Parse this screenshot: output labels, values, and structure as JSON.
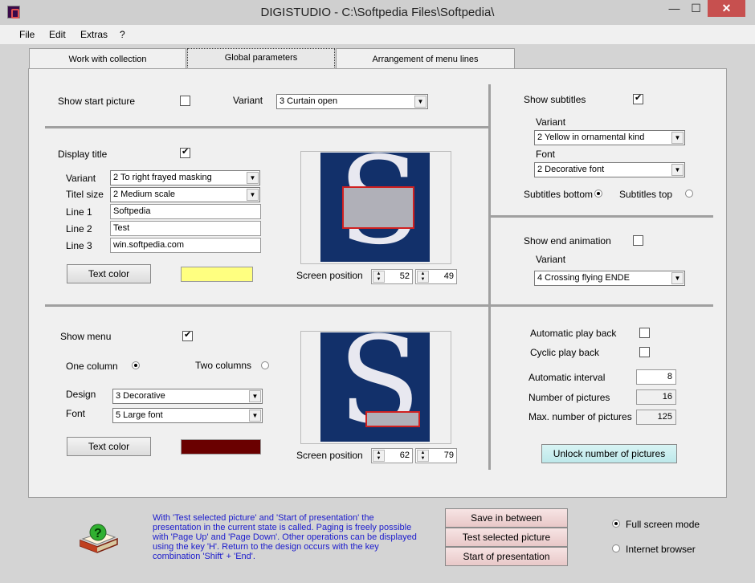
{
  "window": {
    "title": "DIGISTUDIO - C:\\Softpedia Files\\Softpedia\\",
    "min": "—",
    "max": "☐",
    "close": "✕"
  },
  "menu": [
    "File",
    "Edit",
    "Extras",
    "?"
  ],
  "tabs": [
    "Work with collection",
    "Global parameters",
    "Arrangement of menu lines"
  ],
  "start_picture": {
    "label": "Show start picture",
    "checked": false,
    "variant_label": "Variant",
    "variant": "3 Curtain open"
  },
  "title": {
    "label": "Display title",
    "checked": true,
    "variant_label": "Variant",
    "variant": "2 To right frayed masking",
    "size_label": "Titel size",
    "size": "2 Medium scale",
    "line1_label": "Line 1",
    "line1": "Softpedia",
    "line2_label": "Line 2",
    "line2": "Test",
    "line3_label": "Line 3",
    "line3": "win.softpedia.com",
    "text_color_label": "Text color",
    "color": "#ffff80",
    "screen_position_label": "Screen position",
    "pos_x": "52",
    "pos_y": "49"
  },
  "menu_opts": {
    "label": "Show menu",
    "checked": true,
    "one_column": "One column",
    "two_columns": "Two columns",
    "selected": "one",
    "design_label": "Design",
    "design": "3 Decorative",
    "font_label": "Font",
    "font": "5 Large font",
    "text_color_label": "Text color",
    "color": "#6a0000",
    "screen_position_label": "Screen position",
    "pos_x": "62",
    "pos_y": "79"
  },
  "subtitles": {
    "label": "Show subtitles",
    "checked": true,
    "variant_label": "Variant",
    "variant": "2 Yellow in ornamental kind",
    "font_label": "Font",
    "font": "2 Decorative font",
    "bottom": "Subtitles bottom",
    "top": "Subtitles top",
    "selected": "bottom"
  },
  "end_animation": {
    "label": "Show end animation",
    "checked": false,
    "variant_label": "Variant",
    "variant": "4 Crossing flying ENDE"
  },
  "playback": {
    "auto_label": "Automatic play back",
    "auto_checked": false,
    "cyclic_label": "Cyclic play back",
    "cyclic_checked": false,
    "interval_label": "Automatic interval",
    "interval": "8",
    "num_label": "Number of pictures",
    "num": "16",
    "max_label": "Max. number of pictures",
    "max": "125",
    "unlock": "Unlock number of pictures"
  },
  "preview_letter": "S",
  "help_text": "With 'Test selected picture' and 'Start of presentation' the presentation in the current state is called. Paging is freely possible with 'Page Up' and 'Page Down'. Other operations can be displayed using the key 'H'. Return to the design occurs with the key combination 'Shift' + 'End'.",
  "actions": {
    "save": "Save in between",
    "test": "Test selected picture",
    "start": "Start of presentation"
  },
  "mode": {
    "full": "Full screen mode",
    "browser": "Internet browser",
    "selected": "full"
  }
}
